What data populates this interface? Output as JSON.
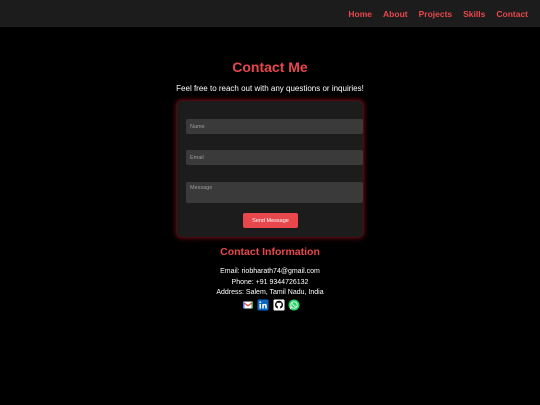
{
  "nav": {
    "items": [
      {
        "label": "Home"
      },
      {
        "label": "About"
      },
      {
        "label": "Projects"
      },
      {
        "label": "Skills"
      },
      {
        "label": "Contact"
      }
    ]
  },
  "contact": {
    "title": "Contact Me",
    "subtitle": "Feel free to reach out with any questions or inquiries!",
    "form": {
      "name_placeholder": "Name",
      "email_placeholder": "Email",
      "message_placeholder": "Message",
      "send_label": "Send Message"
    }
  },
  "info": {
    "title": "Contact Information",
    "email": "Email: riobharath74@gmail.com",
    "phone": "Phone: +91 9344726132",
    "address": "Address: Salem, Tamil Nadu, India",
    "socials": [
      {
        "icon": "gmail-icon"
      },
      {
        "icon": "linkedin-icon"
      },
      {
        "icon": "github-icon"
      },
      {
        "icon": "whatsapp-icon"
      }
    ]
  },
  "colors": {
    "accent": "#e8474c",
    "background": "#000000",
    "navbar": "#1c1c1c",
    "card": "#1c1c1c",
    "input": "#3a3a3a"
  }
}
